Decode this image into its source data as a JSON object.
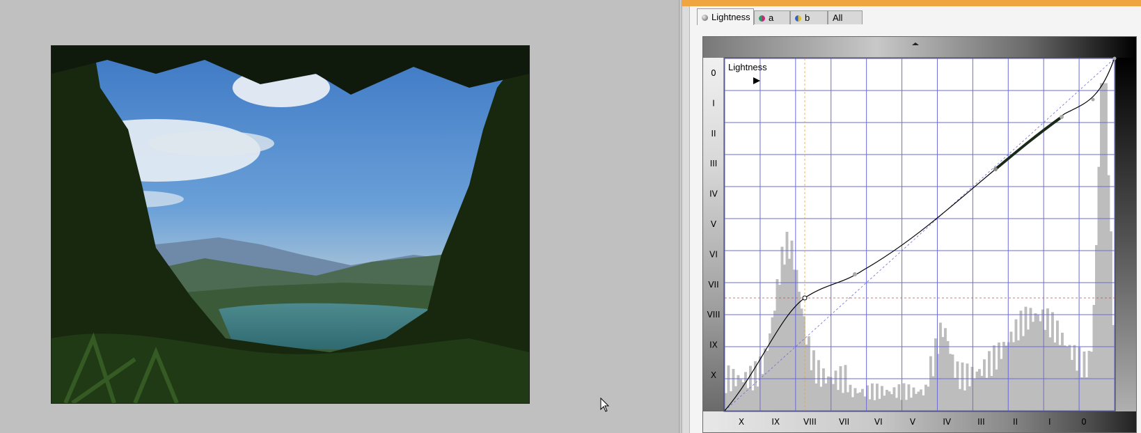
{
  "tabs": [
    {
      "label": "Lightness",
      "icon": "gray-channel-icon",
      "active": true
    },
    {
      "label": "a",
      "icon": "a-channel-icon",
      "active": false
    },
    {
      "label": "b",
      "icon": "b-channel-icon",
      "active": false
    },
    {
      "label": "All",
      "icon": "",
      "active": false
    }
  ],
  "graph": {
    "title": "Lightness",
    "y_zone_labels": [
      "0",
      "I",
      "II",
      "III",
      "IV",
      "V",
      "VI",
      "VII",
      "VIII",
      "IX",
      "X"
    ],
    "x_zone_labels": [
      "X",
      "IX",
      "VIII",
      "VII",
      "VI",
      "V",
      "IV",
      "III",
      "II",
      "I",
      "0"
    ]
  },
  "colors": {
    "accent": "#f0a640",
    "grid": "#6b6bd6",
    "histogram": "#bdbdbd",
    "curve": "#000000",
    "guide_vertical": "#e6a040",
    "guide_horizontal": "#e04040"
  }
}
